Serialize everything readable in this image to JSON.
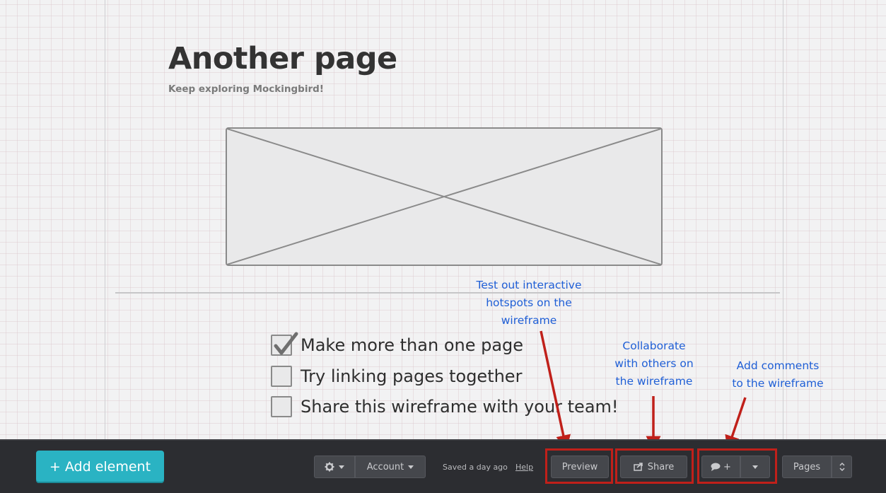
{
  "page": {
    "title": "Another page",
    "subtitle": "Keep exploring Mockingbird!"
  },
  "checklist": [
    {
      "label": "Make more than one page",
      "checked": true
    },
    {
      "label": "Try linking pages together",
      "checked": false
    },
    {
      "label": "Share this wireframe with your team!",
      "checked": false
    }
  ],
  "annotations": {
    "preview_note": [
      "Test out interactive",
      "hotspots on the",
      "wireframe"
    ],
    "share_note": [
      "Collaborate",
      "with others on",
      "the wireframe"
    ],
    "comment_note": [
      "Add comments",
      "to the wireframe"
    ],
    "color": "#1f5fd6",
    "highlight_color": "#c0201a"
  },
  "toolbar": {
    "add_element": "+ Add element",
    "settings_icon": "gear-icon",
    "account": "Account",
    "saved_status": "Saved a day ago",
    "help": "Help",
    "preview": "Preview",
    "share": "Share",
    "share_icon": "share-icon",
    "comment_icon": "comment-icon",
    "comment_plus": "+",
    "pages": "Pages",
    "accent": "#2ab3c3"
  }
}
